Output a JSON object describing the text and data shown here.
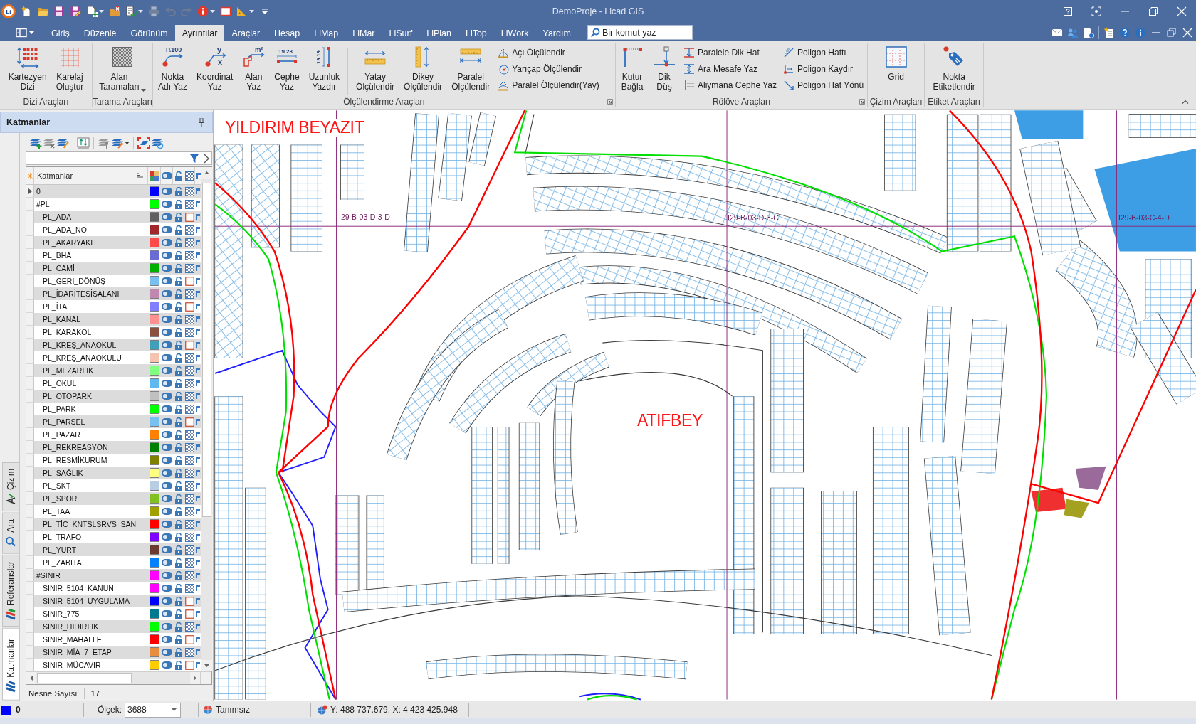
{
  "title_bar": {
    "logo": "Li",
    "quick_access": [
      {
        "kind": "new",
        "disabled": false,
        "dropdown": false
      },
      {
        "kind": "open",
        "disabled": false,
        "dropdown": false
      },
      {
        "kind": "save",
        "disabled": false,
        "dropdown": false
      },
      {
        "kind": "save_as",
        "disabled": false,
        "dropdown": false
      },
      {
        "kind": "import",
        "disabled": false,
        "dropdown": true
      },
      {
        "kind": "close_project",
        "disabled": false,
        "dropdown": false
      },
      {
        "kind": "layer_list",
        "disabled": false,
        "dropdown": true
      },
      {
        "kind": "print",
        "disabled": true,
        "dropdown": false
      },
      {
        "kind": "undo",
        "disabled": true,
        "dropdown": false
      },
      {
        "kind": "redo",
        "disabled": true,
        "dropdown": false
      },
      {
        "kind": "info",
        "disabled": false,
        "dropdown": true
      },
      {
        "kind": "frame",
        "disabled": false,
        "dropdown": false
      },
      {
        "kind": "ruler",
        "disabled": false,
        "dropdown": true
      },
      {
        "kind": "customize",
        "disabled": false,
        "dropdown": false
      }
    ],
    "title": "DemoProje - Licad GIS"
  },
  "menu": {
    "tabs": [
      {
        "label": "Giriş",
        "selected": false
      },
      {
        "label": "Düzenle",
        "selected": false
      },
      {
        "label": "Görünüm",
        "selected": false
      },
      {
        "label": "Ayrıntılar",
        "selected": true
      },
      {
        "label": "Araçlar",
        "selected": false
      },
      {
        "label": "Hesap",
        "selected": false
      },
      {
        "label": "LiMap",
        "selected": false
      },
      {
        "label": "LiMar",
        "selected": false
      },
      {
        "label": "LiSurf",
        "selected": false
      },
      {
        "label": "LiPlan",
        "selected": false
      },
      {
        "label": "LiTop",
        "selected": false
      },
      {
        "label": "LiWork",
        "selected": false
      },
      {
        "label": "Yardım",
        "selected": false
      }
    ],
    "search": {
      "placeholder": "Bir komut yaz"
    }
  },
  "ribbon": {
    "groups": [
      {
        "label": "Dizi Araçları",
        "launcher": false,
        "items": [
          {
            "kind": "large",
            "label": "Kartezyen\nDizi",
            "dropdown": false
          },
          {
            "kind": "large",
            "label": "Karelaj\nOluştur",
            "dropdown": false
          }
        ]
      },
      {
        "label": "Tarama Araçları",
        "launcher": false,
        "items": [
          {
            "kind": "large",
            "label": "Alan\nTaramaları",
            "dropdown": true
          }
        ]
      },
      {
        "label": "Ölçülendirme Araçları",
        "launcher": true,
        "items": [
          {
            "kind": "large",
            "label": "Nokta\nAdı Yaz",
            "dropdown": false,
            "icon_text": [
              "P.100"
            ]
          },
          {
            "kind": "large",
            "label": "Koordinat\nYaz",
            "dropdown": false,
            "icon_text": [
              "y",
              "x"
            ]
          },
          {
            "kind": "large",
            "label": "Alan\nYaz",
            "dropdown": false,
            "icon_text": [
              "m²"
            ]
          },
          {
            "kind": "large",
            "label": "Cephe\nYaz",
            "dropdown": false,
            "icon_text": [
              "19.23"
            ]
          },
          {
            "kind": "large",
            "label": "Uzunluk\nYazdır",
            "dropdown": false,
            "icon_text": [
              "19.19"
            ]
          },
          {
            "kind": "separator"
          },
          {
            "kind": "large",
            "label": "Yatay\nÖlçülendir",
            "dropdown": false
          },
          {
            "kind": "large",
            "label": "Dikey\nÖlçülendir",
            "dropdown": false
          },
          {
            "kind": "large",
            "label": "Paralel\nÖlçülendir",
            "dropdown": false
          },
          {
            "kind": "column",
            "items": [
              {
                "label": "Açı Ölçülendir"
              },
              {
                "label": "Yarıçap Ölçülendir"
              },
              {
                "label": "Paralel Ölçülendir(Yay)"
              }
            ]
          }
        ]
      },
      {
        "label": "Rölöve Araçları",
        "launcher": true,
        "items": [
          {
            "kind": "large",
            "label": "Kutur\nBağla",
            "dropdown": false
          },
          {
            "kind": "large",
            "label": "Dik\nDüş",
            "dropdown": false
          },
          {
            "kind": "column",
            "items": [
              {
                "label": "Paralele Dik Hat"
              },
              {
                "label": "Ara Mesafe Yaz"
              },
              {
                "label": "Aliymana Cephe Yaz"
              }
            ]
          },
          {
            "kind": "column",
            "items": [
              {
                "label": "Poligon Hattı"
              },
              {
                "label": "Poligon Kaydır"
              },
              {
                "label": "Poligon Hat Yönü"
              }
            ]
          }
        ]
      },
      {
        "label": "Çizim Araçları",
        "launcher": false,
        "items": [
          {
            "kind": "large",
            "label": "Grid",
            "dropdown": false
          }
        ]
      },
      {
        "label": "Etiket Araçları",
        "launcher": false,
        "items": [
          {
            "kind": "large",
            "label": "Nokta\nEtiketlendir",
            "dropdown": false
          }
        ]
      }
    ]
  },
  "layers_panel": {
    "title": "Katmanlar",
    "side_tabs": [
      {
        "label": "Çizim",
        "selected": false
      },
      {
        "label": "Ara",
        "selected": false
      },
      {
        "label": "Referanslar",
        "selected": false
      },
      {
        "label": "Katmanlar",
        "selected": true
      }
    ],
    "table": {
      "header": "Katmanlar",
      "layers": [
        {
          "name": "0",
          "color": "#0000ff",
          "visible": true,
          "locked": false,
          "hatch": true,
          "selected": true
        },
        {
          "name": "#PL",
          "color": "#00ff00",
          "visible": true,
          "locked": false,
          "hatch": true,
          "selected": false,
          "children": [
            {
              "name": "PL_ADA",
              "color": "#606060",
              "visible": true,
              "locked": false,
              "hatch": false,
              "selected": false
            },
            {
              "name": "PL_ADA_NO",
              "color": "#a0282a",
              "visible": true,
              "locked": false,
              "hatch": true,
              "selected": false
            },
            {
              "name": "PL_AKARYAKIT",
              "color": "#ff4848",
              "visible": true,
              "locked": false,
              "hatch": true,
              "selected": false
            },
            {
              "name": "PL_BHA",
              "color": "#6b6bd6",
              "visible": true,
              "locked": false,
              "hatch": true,
              "selected": false
            },
            {
              "name": "PL_CAMİ",
              "color": "#00b000",
              "visible": true,
              "locked": false,
              "hatch": true,
              "selected": false
            },
            {
              "name": "PL_GERİ_DÖNÜŞ",
              "color": "#78bef0",
              "visible": true,
              "locked": false,
              "hatch": false,
              "selected": false
            },
            {
              "name": "PL_İDARİTESİSALANI",
              "color": "#c088b0",
              "visible": true,
              "locked": false,
              "hatch": true,
              "selected": false
            },
            {
              "name": "PL_İTA",
              "color": "#8080ff",
              "visible": true,
              "locked": false,
              "hatch": false,
              "selected": false
            },
            {
              "name": "PL_KANAL",
              "color": "#ff9090",
              "visible": true,
              "locked": false,
              "hatch": true,
              "selected": false
            },
            {
              "name": "PL_KARAKOL",
              "color": "#8a5040",
              "visible": true,
              "locked": false,
              "hatch": true,
              "selected": false
            },
            {
              "name": "PL_KREŞ_ANAOKUL",
              "color": "#40a0b8",
              "visible": true,
              "locked": false,
              "hatch": false,
              "selected": false
            },
            {
              "name": "PL_KREŞ_ANAOKULU",
              "color": "#f4c4b0",
              "visible": true,
              "locked": false,
              "hatch": true,
              "selected": false
            },
            {
              "name": "PL_MEZARLIK",
              "color": "#80ff80",
              "visible": true,
              "locked": false,
              "hatch": true,
              "selected": false
            },
            {
              "name": "PL_OKUL",
              "color": "#60b8f0",
              "visible": true,
              "locked": false,
              "hatch": true,
              "selected": false
            },
            {
              "name": "PL_OTOPARK",
              "color": "#c0c0c0",
              "visible": true,
              "locked": false,
              "hatch": true,
              "selected": false
            },
            {
              "name": "PL_PARK",
              "color": "#00ff00",
              "visible": true,
              "locked": false,
              "hatch": true,
              "selected": false
            },
            {
              "name": "PL_PARSEL",
              "color": "#78c0f0",
              "visible": true,
              "locked": false,
              "hatch": false,
              "selected": false
            },
            {
              "name": "PL_PAZAR",
              "color": "#ff8000",
              "visible": true,
              "locked": false,
              "hatch": true,
              "selected": false
            },
            {
              "name": "PL_REKREASYON",
              "color": "#008000",
              "visible": true,
              "locked": false,
              "hatch": true,
              "selected": false
            },
            {
              "name": "PL_RESMİKURUM",
              "color": "#808000",
              "visible": true,
              "locked": false,
              "hatch": true,
              "selected": false
            },
            {
              "name": "PL_SAĞLIK",
              "color": "#ffff80",
              "visible": true,
              "locked": false,
              "hatch": true,
              "selected": false
            },
            {
              "name": "PL_SKT",
              "color": "#b8cce4",
              "visible": true,
              "locked": false,
              "hatch": true,
              "selected": false
            },
            {
              "name": "PL_SPOR",
              "color": "#80c020",
              "visible": true,
              "locked": false,
              "hatch": true,
              "selected": false
            },
            {
              "name": "PL_TAA",
              "color": "#a0a000",
              "visible": true,
              "locked": false,
              "hatch": true,
              "selected": false
            },
            {
              "name": "PL_TİC_KNTSLSRVS_SAN",
              "color": "#ff0000",
              "visible": true,
              "locked": false,
              "hatch": true,
              "selected": false
            },
            {
              "name": "PL_TRAFO",
              "color": "#8000ff",
              "visible": true,
              "locked": false,
              "hatch": true,
              "selected": false
            },
            {
              "name": "PL_YURT",
              "color": "#6a3a30",
              "visible": true,
              "locked": false,
              "hatch": true,
              "selected": false
            },
            {
              "name": "PL_ZABITA",
              "color": "#0080ff",
              "visible": true,
              "locked": false,
              "hatch": true,
              "selected": false
            }
          ]
        },
        {
          "name": "#SINIR",
          "color": "#ff00ff",
          "visible": true,
          "locked": false,
          "hatch": true,
          "selected": false,
          "children": [
            {
              "name": "SINIR_5104_KANUN",
              "color": "#ff00ff",
              "visible": true,
              "locked": false,
              "hatch": true,
              "selected": false
            },
            {
              "name": "SINIR_5104_UYGULAMA",
              "color": "#0000ff",
              "visible": true,
              "locked": false,
              "hatch": false,
              "selected": false
            },
            {
              "name": "SINIR_775",
              "color": "#007890",
              "visible": true,
              "locked": false,
              "hatch": false,
              "selected": false
            },
            {
              "name": "SINIR_HIDIRLIK",
              "color": "#00ff00",
              "visible": true,
              "locked": false,
              "hatch": true,
              "selected": false
            },
            {
              "name": "SINIR_MAHALLE",
              "color": "#ff0000",
              "visible": true,
              "locked": false,
              "hatch": false,
              "selected": false
            },
            {
              "name": "SINIR_MİA_7_ETAP",
              "color": "#e88c40",
              "visible": true,
              "locked": false,
              "hatch": true,
              "selected": false
            },
            {
              "name": "SINIR_MÜCAVİR",
              "color": "#ffcc00",
              "visible": true,
              "locked": false,
              "hatch": false,
              "selected": false
            }
          ]
        }
      ]
    },
    "object_count": {
      "label": "Nesne Sayısı",
      "value": "17"
    }
  },
  "map": {
    "labels": [
      {
        "kind": "district",
        "text": "YILDIRIM BEYAZIT"
      },
      {
        "kind": "district",
        "text": "ATIFBEY"
      },
      {
        "kind": "sheet",
        "text": "I29-B-03-D-3-D"
      },
      {
        "kind": "sheet",
        "text": "I29-B-03-D-3-C"
      },
      {
        "kind": "sheet",
        "text": "I29-B-03-C-4-D"
      }
    ]
  },
  "status_bar": {
    "current_layer": {
      "color": "#0000ff",
      "name": "0"
    },
    "scale": {
      "label": "Ölçek:",
      "value": "3688"
    },
    "projection": "Tanımsız",
    "coordinates": "Y: 488 737.679, X: 4 423 425.948"
  }
}
